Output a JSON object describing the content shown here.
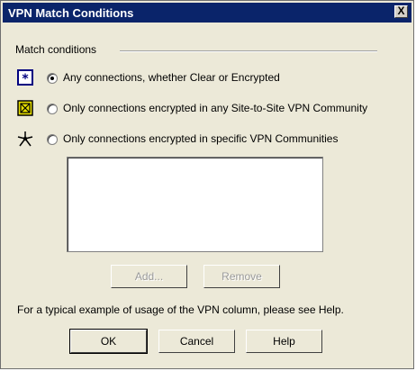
{
  "window": {
    "title": "VPN Match Conditions",
    "close_label": "X"
  },
  "group": {
    "label": "Match conditions"
  },
  "options": [
    {
      "label": "Any connections, whether Clear or Encrypted",
      "icon": "star-box-icon",
      "checked": true
    },
    {
      "label": "Only connections encrypted in any Site-to-Site VPN Community",
      "icon": "site-to-site-community-icon",
      "checked": false
    },
    {
      "label": "Only connections encrypted in specific VPN Communities",
      "icon": "vpn-community-star-icon",
      "checked": false
    }
  ],
  "list_buttons": {
    "add": "Add...",
    "remove": "Remove"
  },
  "help_text": "For a typical example of usage of the VPN column, please see Help.",
  "dialog_buttons": {
    "ok": "OK",
    "cancel": "Cancel",
    "help": "Help"
  }
}
